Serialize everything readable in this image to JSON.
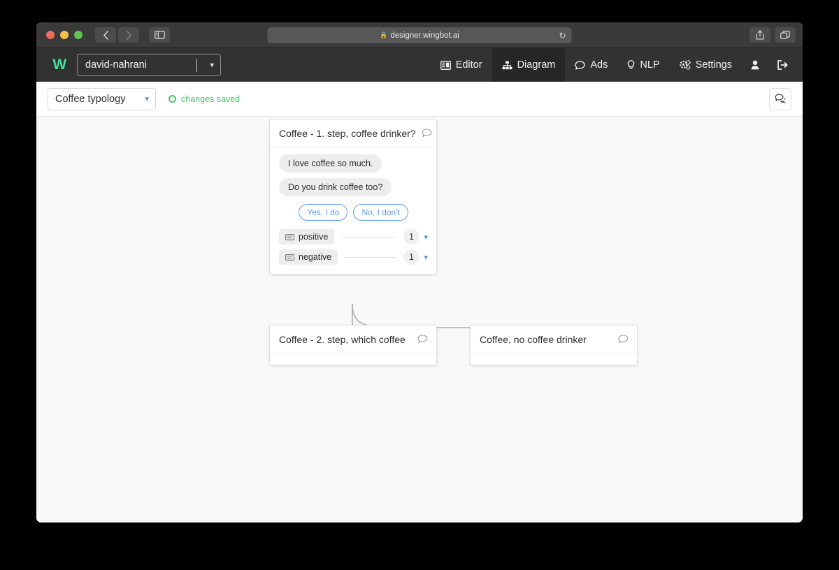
{
  "browser": {
    "url": "designer.wingbot.ai",
    "lock_icon": "lock-icon",
    "reload_icon": "reload-icon",
    "back_icon": "chevron-left-icon",
    "forward_icon": "chevron-right-icon",
    "sidebar_icon": "sidebar-toggle-icon",
    "share_icon": "share-icon",
    "tabs_icon": "tab-overview-icon",
    "new_tab_label": "+"
  },
  "app_nav": {
    "logo": "W",
    "bot_name": "david-nahrani",
    "bot_chevron": "chevron-down-icon",
    "items": [
      {
        "label": "Editor",
        "icon": "editor-icon",
        "active": false
      },
      {
        "label": "Diagram",
        "icon": "diagram-icon",
        "active": true
      },
      {
        "label": "Ads",
        "icon": "chat-bubble-icon",
        "active": false
      },
      {
        "label": "NLP",
        "icon": "lightbulb-icon",
        "active": false
      },
      {
        "label": "Settings",
        "icon": "gears-icon",
        "active": false
      }
    ],
    "account_icon": "user-icon",
    "logout_icon": "logout-icon"
  },
  "toolbar": {
    "flow_name": "Coffee typology",
    "flow_chevron": "chevron-down-icon",
    "status_text": "changes saved",
    "status_icon": "circle-ring-icon",
    "status_color": "#4cc469",
    "chat_button_icon": "comments-icon"
  },
  "nodes": [
    {
      "id": "node-1",
      "title": "Coffee - 1. step, coffee drinker?",
      "header_icon": "speech-bubble-icon",
      "messages": [
        "I love coffee so much.",
        "Do you drink coffee too?"
      ],
      "quick_replies": [
        "Yes, I do",
        "No, I don't"
      ],
      "intents": [
        {
          "label": "positive",
          "icon": "keyboard-icon",
          "count": "1",
          "chevron": "chevron-down-icon"
        },
        {
          "label": "negative",
          "icon": "keyboard-icon",
          "count": "1",
          "chevron": "chevron-down-icon"
        }
      ]
    },
    {
      "id": "node-2",
      "title": "Coffee - 2. step, which coffee",
      "header_icon": "speech-bubble-icon",
      "messages": [],
      "quick_replies": [],
      "intents": []
    },
    {
      "id": "node-3",
      "title": "Coffee, no coffee drinker",
      "header_icon": "speech-bubble-icon",
      "messages": [],
      "quick_replies": [],
      "intents": []
    }
  ],
  "colors": {
    "accent_green": "#3fe39b",
    "link_blue": "#5b9cf5",
    "status_green": "#4cc469",
    "nav_bg": "#323232",
    "nav_active_bg": "#262626",
    "canvas_bg": "#f8f8f8",
    "connector": "#b8b8b8"
  }
}
